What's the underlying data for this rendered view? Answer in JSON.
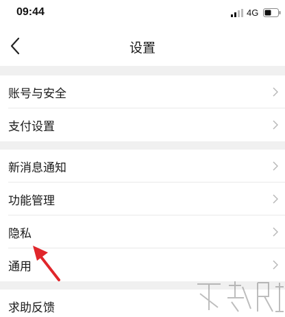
{
  "status_bar": {
    "time": "09:44",
    "network": "4G"
  },
  "nav": {
    "title": "设置"
  },
  "settings_items": [
    {
      "label": "账号与安全"
    },
    {
      "label": "支付设置"
    },
    {
      "label": "新消息通知"
    },
    {
      "label": "功能管理"
    },
    {
      "label": "隐私"
    },
    {
      "label": "通用"
    },
    {
      "label": "求助反馈"
    }
  ],
  "icons": {
    "back": "chevron-left-icon",
    "row_chevron": "chevron-right-icon",
    "pointer": "red-arrow-annotation",
    "watermark": "download-site-watermark"
  },
  "colors": {
    "background": "#f0f0f0",
    "card": "#ffffff",
    "text": "#1a1a1a",
    "chevron": "#b8b8b8",
    "annotation_arrow": "#e0262b"
  }
}
